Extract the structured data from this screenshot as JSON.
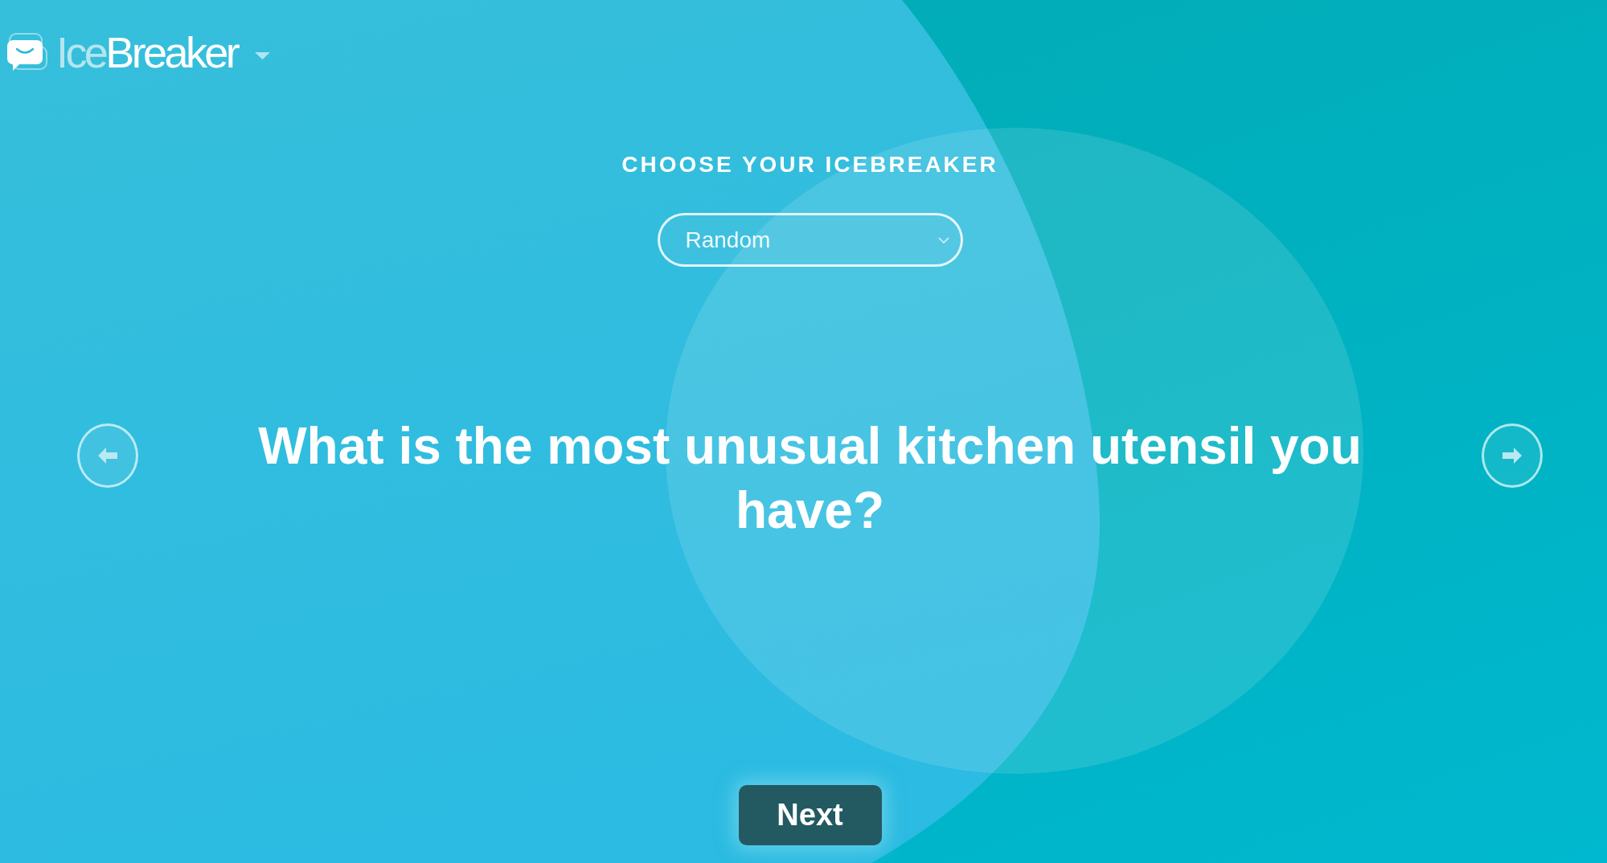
{
  "header": {
    "logo": {
      "prefix": "Ice",
      "name": "Breaker"
    }
  },
  "picker": {
    "heading": "CHOOSE YOUR ICEBREAKER",
    "select": {
      "value": "Random"
    }
  },
  "question": {
    "text": "What is the most unusual kitchen utensil you have?"
  },
  "buttons": {
    "next": "Next"
  }
}
